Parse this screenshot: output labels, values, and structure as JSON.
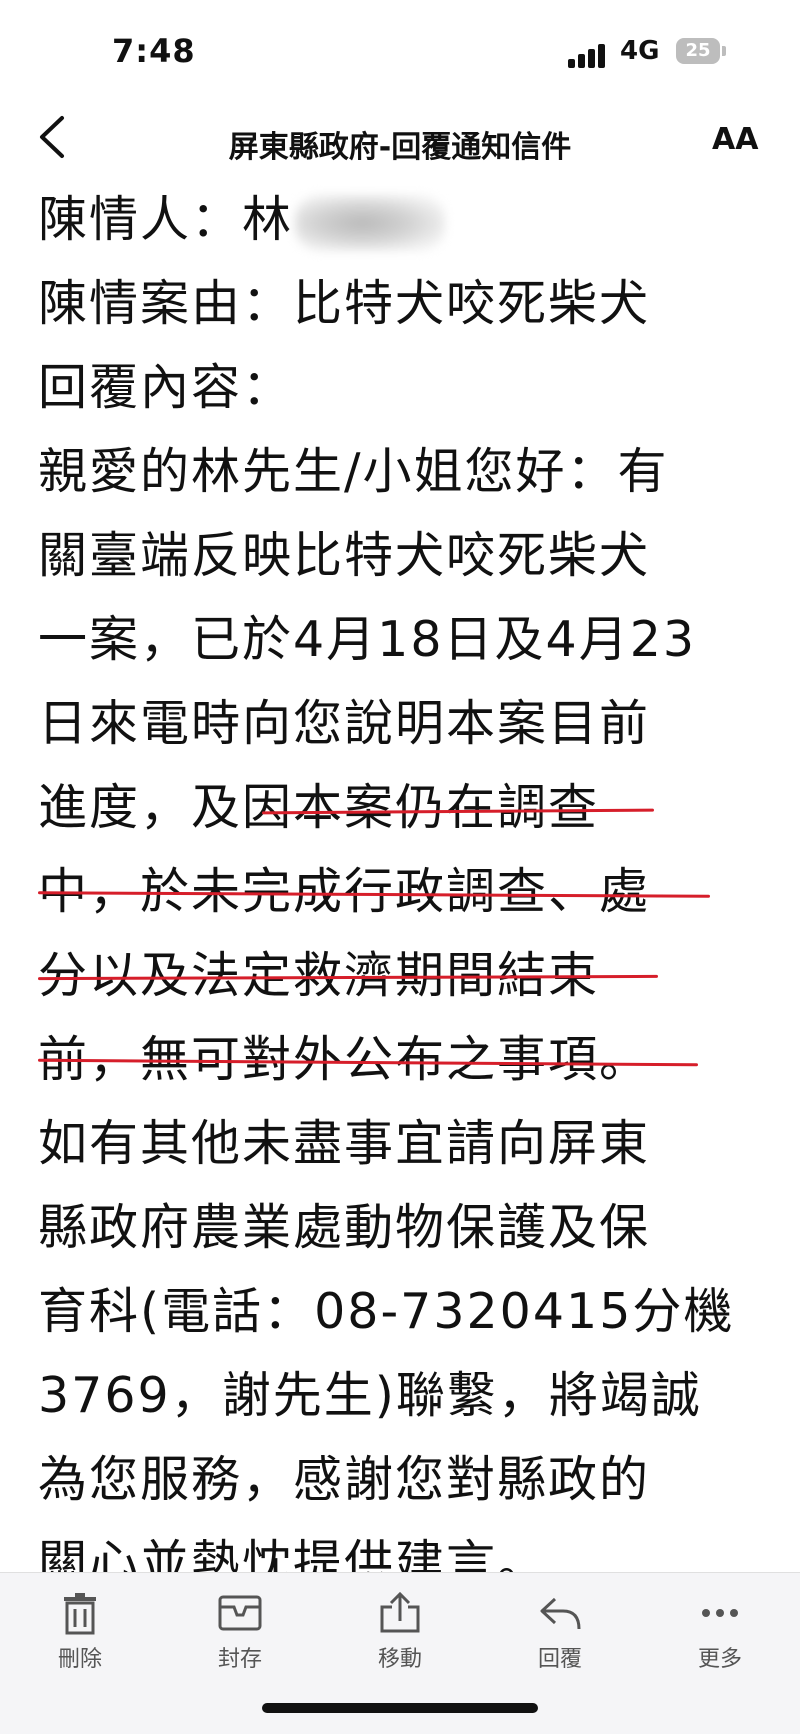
{
  "status_bar": {
    "time": "7:48",
    "network": "4G",
    "battery": "25"
  },
  "nav": {
    "title": "屏東縣政府-回覆通知信件",
    "font_button": "AA"
  },
  "email": {
    "lines": [
      "陳情人：林",
      "陳情案由：比特犬咬死柴犬",
      "回覆內容：",
      "親愛的林先生/小姐您好：有",
      "關臺端反映比特犬咬死柴犬",
      "一案，已於4月18日及4月23",
      "日來電時向您說明本案目前",
      "進度，及因本案仍在調查",
      "中，於未完成行政調查、處",
      "分以及法定救濟期間結束",
      "前，無可對外公布之事項。",
      "如有其他未盡事宜請向屏東",
      "縣政府農業處動物保護及保",
      "育科(電話：08-7320415分機",
      "3769，謝先生)聯繫，將竭誠",
      "為您服務，感謝您對縣政的",
      "關心並熱忱提供建言。"
    ]
  },
  "toolbar": {
    "items": [
      {
        "label": "刪除",
        "icon": "trash-icon"
      },
      {
        "label": "封存",
        "icon": "archive-icon"
      },
      {
        "label": "移動",
        "icon": "move-icon"
      },
      {
        "label": "回覆",
        "icon": "reply-icon"
      },
      {
        "label": "更多",
        "icon": "more-icon"
      }
    ]
  },
  "colors": {
    "underline": "#d61e2a",
    "toolbar_bg": "#f5f5f7"
  }
}
